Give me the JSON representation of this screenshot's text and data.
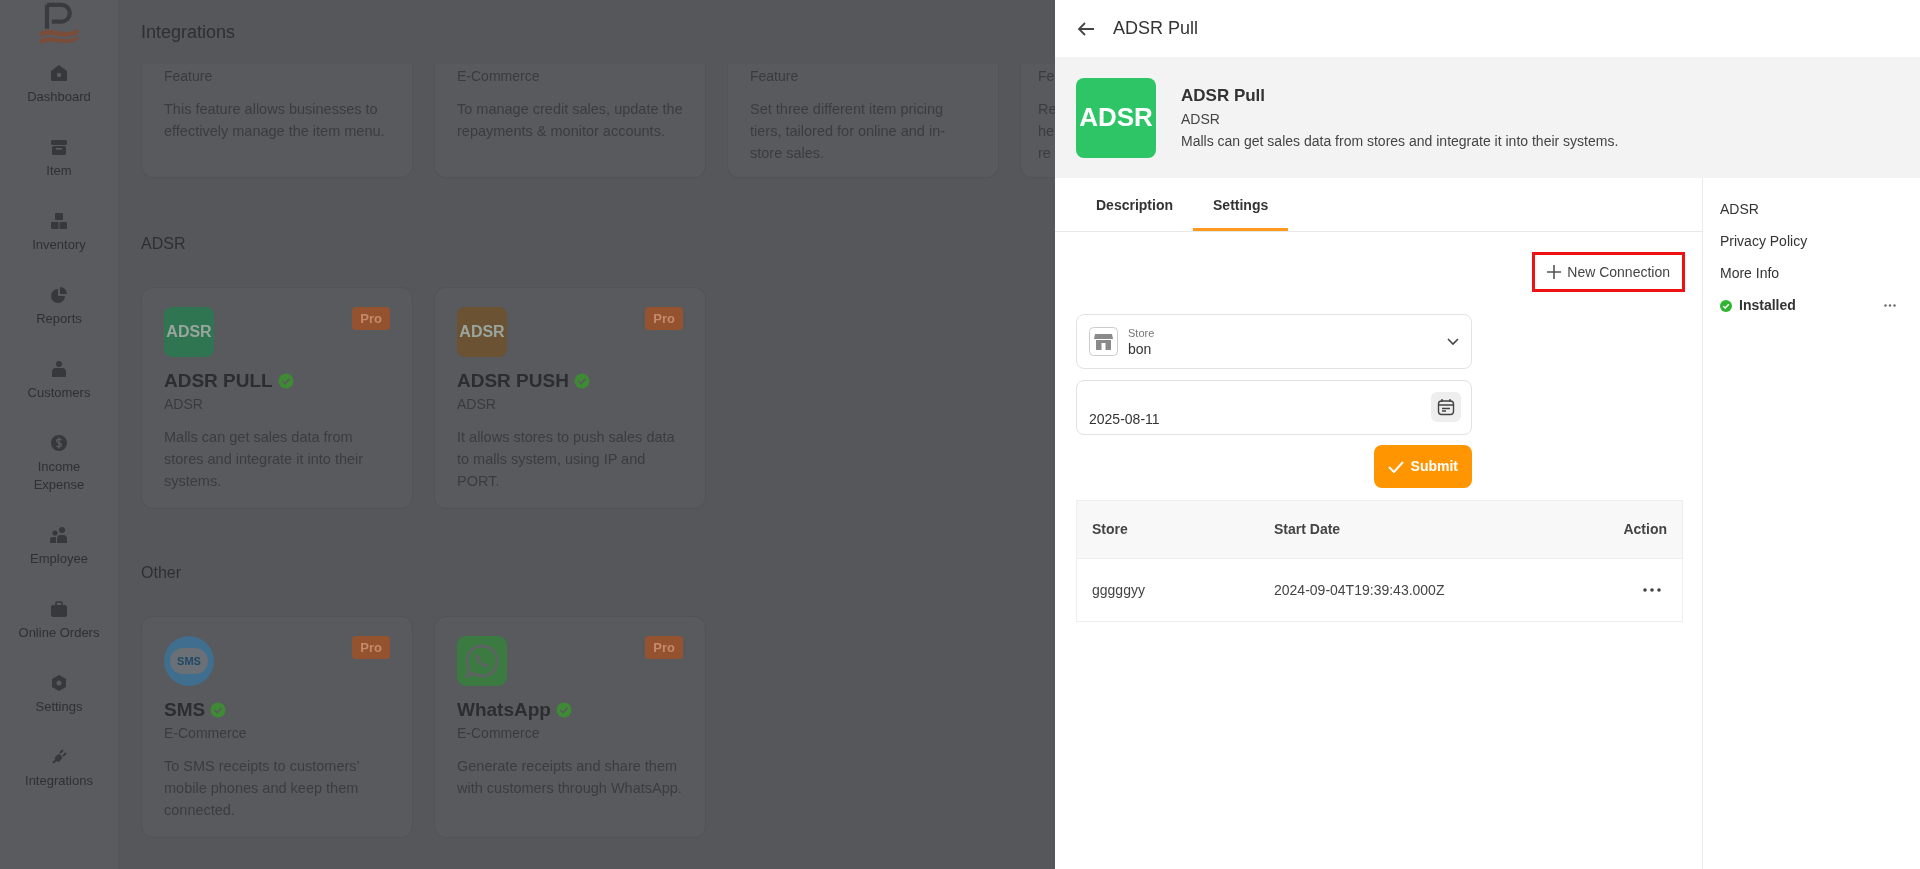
{
  "sidebar": {
    "items": [
      {
        "label": "Dashboard"
      },
      {
        "label": "Item"
      },
      {
        "label": "Inventory"
      },
      {
        "label": "Reports"
      },
      {
        "label": "Customers"
      },
      {
        "label": "Income\nExpense"
      },
      {
        "label": "Employee"
      },
      {
        "label": "Online Orders"
      },
      {
        "label": "Settings"
      },
      {
        "label": "Integrations"
      }
    ]
  },
  "page": {
    "title": "Integrations",
    "sections": [
      {
        "cards": [
          {
            "category": "Feature",
            "description": "This feature allows businesses to effectively manage the item menu."
          },
          {
            "category": "E-Commerce",
            "description": "To manage credit sales, update the repayments & monitor accounts."
          },
          {
            "category": "Feature",
            "description": "Set three different item pricing tiers, tailored for online and in-store sales."
          },
          {
            "category": "Fe",
            "description": "Re\nhe\nre"
          }
        ]
      },
      {
        "heading": "ADSR",
        "cards": [
          {
            "logo": {
              "kind": "text",
              "text": "ADSR",
              "color": "#2f7551"
            },
            "pro": "Pro",
            "name": "ADSR PULL",
            "installed": true,
            "category": "ADSR",
            "description": "Malls can get sales data from stores and integrate it into their systems."
          },
          {
            "logo": {
              "kind": "text",
              "text": "ADSR",
              "color": "#6a5232"
            },
            "pro": "Pro",
            "name": "ADSR PUSH",
            "installed": true,
            "category": "ADSR",
            "description": "It allows stores to push sales data to malls system, using IP and PORT."
          }
        ]
      },
      {
        "heading": "Other",
        "cards": [
          {
            "logo": {
              "kind": "sms",
              "text": "SMS",
              "color": "#3f6e8e"
            },
            "pro": "Pro",
            "name": "SMS",
            "installed": true,
            "category": "E-Commerce",
            "description": "To SMS receipts to customers’ mobile phones and keep them connected."
          },
          {
            "logo": {
              "kind": "whatsapp",
              "color": "#3b7a41"
            },
            "pro": "Pro",
            "name": "WhatsApp",
            "installed": true,
            "category": "E-Commerce",
            "description": "Generate receipts and share them with customers through WhatsApp."
          }
        ]
      }
    ]
  },
  "panel": {
    "title": "ADSR Pull",
    "app": {
      "logo_text": "ADSR",
      "name": "ADSR Pull",
      "vendor": "ADSR",
      "description": "Malls can get sales data from stores and integrate it into their systems."
    },
    "tabs": [
      {
        "label": "Description",
        "selected": false
      },
      {
        "label": "Settings",
        "selected": true
      }
    ],
    "new_connection": {
      "label": "New Connection",
      "highlighted": true
    },
    "store_select": {
      "label": "Store",
      "value": "bon"
    },
    "date_field": {
      "value": "2025-08-11"
    },
    "submit": {
      "label": "Submit"
    },
    "table": {
      "columns": [
        "Store",
        "Start Date",
        "Action"
      ],
      "rows": [
        {
          "cells": [
            "gggggyy",
            "2024-09-04T19:39:43.000Z"
          ]
        }
      ]
    },
    "side_links": [
      {
        "label": "ADSR"
      },
      {
        "label": "Privacy Policy"
      },
      {
        "label": "More Info"
      }
    ],
    "status": {
      "label": "Installed",
      "installed": true
    }
  }
}
